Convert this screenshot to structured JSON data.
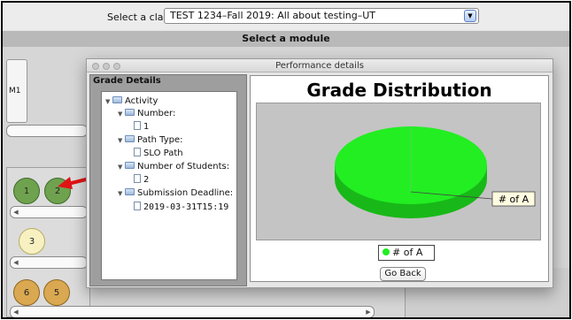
{
  "top": {
    "class_label": "Select a class:",
    "class_value": "TEST 1234–Fall 2019: All about testing–UT",
    "module_bar": "Select a module"
  },
  "module_card": {
    "label": "M1"
  },
  "nodes": {
    "row1": [
      "1",
      "2"
    ],
    "row2": [
      "3"
    ],
    "row3": [
      "6",
      "5"
    ]
  },
  "colors": {
    "node_done": "#6fa24f",
    "node_pending": "#f7f1c2",
    "node_partial": "#d9a850",
    "pie": "#22ee22",
    "arrow": "#e01515"
  },
  "dialog": {
    "title": "Performance details",
    "grade_details_title": "Grade Details",
    "tree": {
      "root": "Activity",
      "number_label": "Number:",
      "number_value": "1",
      "path_label": "Path Type:",
      "path_value": "SLO Path",
      "students_label": "Number of Students:",
      "students_value": "2",
      "deadline_label": "Submission Deadline:",
      "deadline_value": "2019-03-31T15:19"
    },
    "go_back": "Go Back"
  },
  "chart_data": {
    "type": "pie",
    "title": "Grade Distribution",
    "slices": [
      {
        "name": "# of A",
        "value": 100,
        "color": "#22ee22"
      }
    ],
    "legend": "bottom",
    "label": "# of A"
  }
}
